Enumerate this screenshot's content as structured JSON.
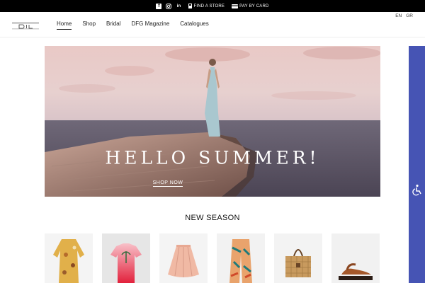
{
  "topbar": {
    "icons": [
      "facebook-icon",
      "instagram-icon",
      "linkedin-icon"
    ],
    "linkedin_text": "in",
    "find_store": "FIND A STORE",
    "pay_by_card": "PAY BY CARD"
  },
  "header": {
    "nav": [
      "Home",
      "Shop",
      "Bridal",
      "DFG Magazine",
      "Catalogues"
    ],
    "active": "Home",
    "languages": [
      "EN",
      "GR"
    ]
  },
  "hero": {
    "title": "HELLO SUMMER!",
    "cta": "SHOP NOW"
  },
  "section": {
    "title": "NEW SEASON"
  },
  "products": [
    {
      "name": "floral-kaftan-dress"
    },
    {
      "name": "pink-gradient-tshirt"
    },
    {
      "name": "pleated-blush-skirt"
    },
    {
      "name": "printed-wide-trousers"
    },
    {
      "name": "woven-basket-bag"
    },
    {
      "name": "tan-leather-sandals"
    }
  ],
  "colors": {
    "topbar": "#000000",
    "accessibility": "#4654b4"
  }
}
